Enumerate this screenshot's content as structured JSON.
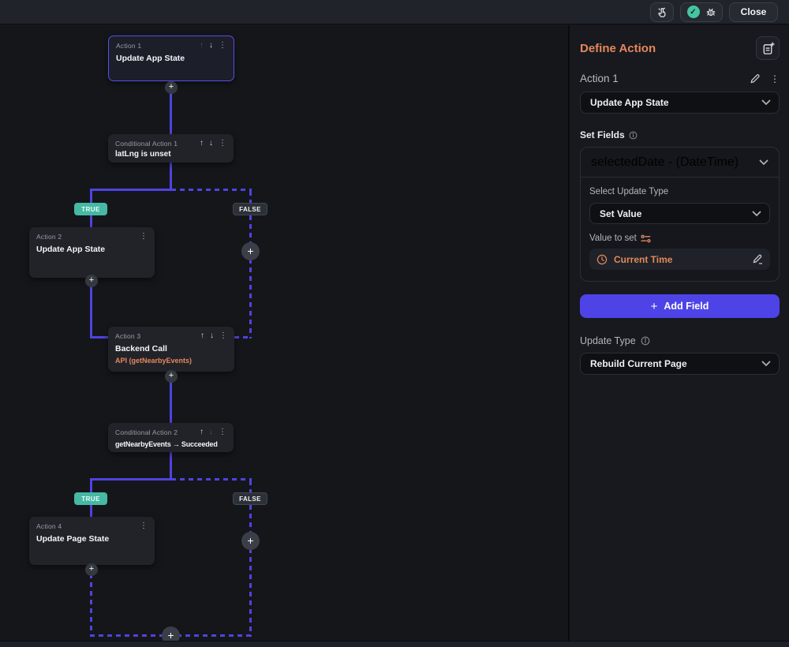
{
  "icons": {
    "up": "↑",
    "down": "↓",
    "kebab": "⋮",
    "plus": "+",
    "check": "✓"
  },
  "topbar": {
    "close_label": "Close"
  },
  "flow": {
    "badge_true": "TRUE",
    "badge_false": "FALSE",
    "nodes": {
      "action1": {
        "label": "Action 1",
        "title": "Update App State"
      },
      "cond1": {
        "label": "Conditional Action 1",
        "title": "latLng is unset"
      },
      "action2": {
        "label": "Action 2",
        "title": "Update App State"
      },
      "action3": {
        "label": "Action 3",
        "title": "Backend Call",
        "subtitle": "API (getNearbyEvents)"
      },
      "cond2": {
        "label": "Conditional Action 2",
        "title": "getNearbyEvents → Succeeded"
      },
      "action4": {
        "label": "Action 4",
        "title": "Update Page State"
      }
    }
  },
  "panel": {
    "title": "Define Action",
    "action_label": "Action 1",
    "action_type": "Update App State",
    "set_fields": {
      "label": "Set Fields",
      "field": "selectedDate - (DateTime)",
      "update_type_label": "Select Update Type",
      "update_type_value": "Set Value",
      "value_label": "Value to set",
      "value": "Current Time"
    },
    "add_field_label": "Add Field",
    "update_type_label": "Update Type",
    "update_type_value": "Rebuild Current Page"
  },
  "colors": {
    "accent_purple": "#4f43e0",
    "accent_orange": "#e5875c",
    "true_badge_teal": "#46b8a3",
    "primary_button_purple": "#4e43e6"
  }
}
